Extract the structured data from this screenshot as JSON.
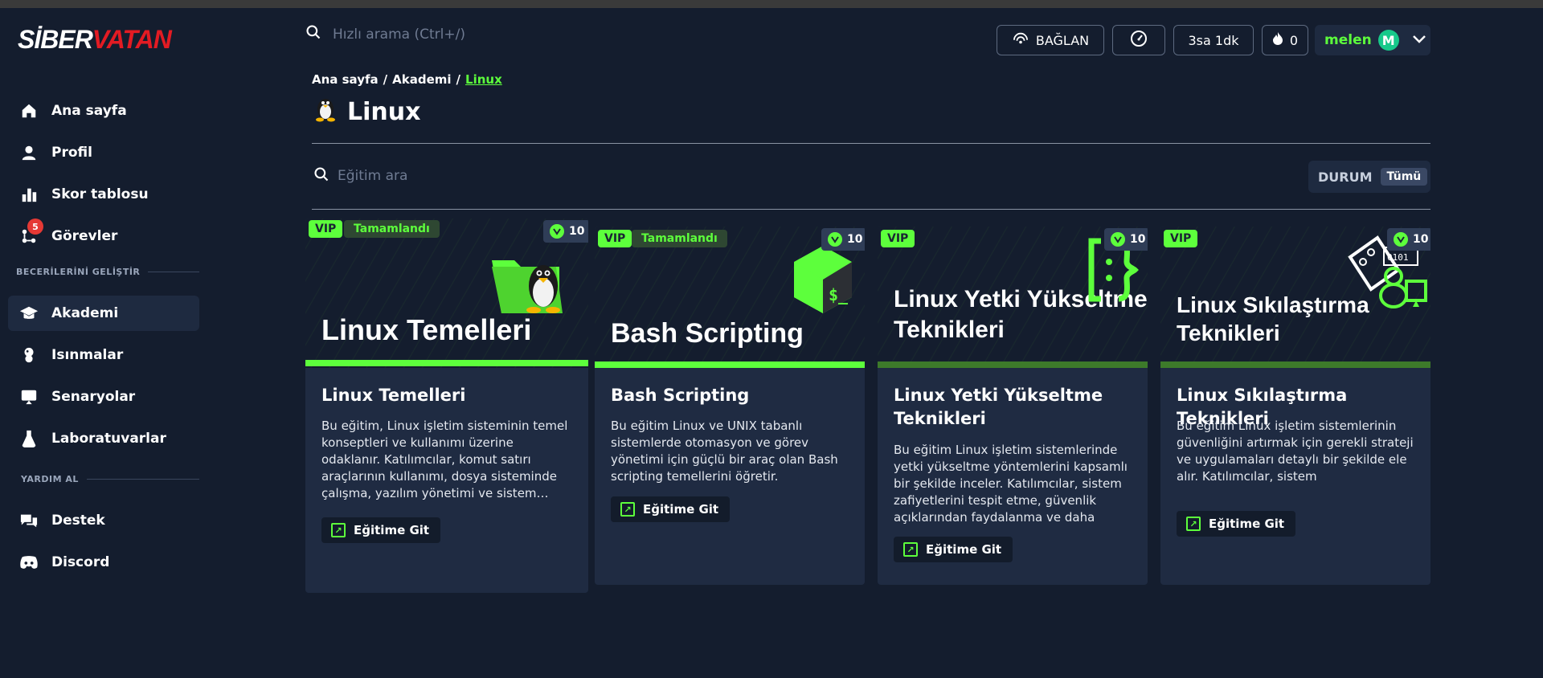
{
  "brand": {
    "logo_part1": "SİBER",
    "logo_part2": "VATAN"
  },
  "sidebar": {
    "items": [
      {
        "label": "Ana sayfa",
        "icon": "home-icon"
      },
      {
        "label": "Profil",
        "icon": "user-icon"
      },
      {
        "label": "Skor tablosu",
        "icon": "bar-chart-icon"
      },
      {
        "label": "Görevler",
        "icon": "tasks-icon",
        "badge": "5"
      },
      {
        "label": "Akademi",
        "icon": "graduation-cap-icon"
      },
      {
        "label": "Isınmalar",
        "icon": "warmup-icon"
      },
      {
        "label": "Senaryolar",
        "icon": "scenario-icon"
      },
      {
        "label": "Laboratuvarlar",
        "icon": "flask-icon"
      },
      {
        "label": "Destek",
        "icon": "chat-icon"
      },
      {
        "label": "Discord",
        "icon": "discord-icon"
      }
    ],
    "sections": {
      "develop": "BECERİLERİNİ GELİŞTİR",
      "help": "YARDIM AL"
    }
  },
  "header": {
    "search_placeholder": "Hızlı arama (Ctrl+/)",
    "connect_label": "BAĞLAN",
    "time_label": "3sa 1dk",
    "flame_count": "0",
    "username": "melen",
    "avatar_letter": "M"
  },
  "breadcrumb": {
    "home": "Ana sayfa",
    "sep": "/",
    "academy": "Akademi",
    "current": "Linux"
  },
  "page": {
    "title": "Linux"
  },
  "filters": {
    "search_placeholder": "Eğitim ara",
    "status_label": "DURUM",
    "status_value": "Tümü"
  },
  "colors": {
    "accent": "#5dff3c",
    "background": "#141d2e",
    "card": "#1f2b42",
    "badge": "#e53935"
  },
  "courses": [
    {
      "vip": "VIP",
      "status": "Tamamlandı",
      "points": "10",
      "hero_title": "Linux Temelleri",
      "title": "Linux Temelleri",
      "description": "Bu eğitim, Linux işletim sisteminin temel konseptleri ve kullanımı üzerine odaklanır. Katılımcılar, komut satırı araçlarının kullanımı, dosya sisteminde çalışma, yazılım yönetimi ve sistem…",
      "button": "Eğitime Git",
      "art": "tux-folder-icon"
    },
    {
      "vip": "VIP",
      "status": "Tamamlandı",
      "points": "10",
      "hero_title": "Bash Scripting",
      "title": "Bash Scripting",
      "description": "Bu eğitim Linux ve UNIX tabanlı sistemlerde otomasyon ve görev yönetimi için güçlü bir araç olan Bash scripting temellerini öğretir.",
      "button": "Eğitime Git",
      "art": "bash-cube-icon"
    },
    {
      "vip": "VIP",
      "status": "",
      "points": "10",
      "hero_title": "Linux Yetki Yükseltme Teknikleri",
      "title": "Linux Yetki Yükseltme Teknikleri",
      "description": "Bu eğitim Linux işletim sistemlerinde yetki yükseltme yöntemlerini kapsamlı bir şekilde inceler. Katılımcılar, sistem zafiyetlerini tespit etme, güvenlik açıklarından faydalanma ve daha yüks…",
      "button": "Eğitime Git",
      "art": "brackets-icon"
    },
    {
      "vip": "VIP",
      "status": "",
      "points": "10",
      "hero_title": "Linux Sıkılaştırma Teknikleri",
      "title": "Linux Sıkılaştırma Teknikleri",
      "description": "Bu eğitim Linux işletim sistemlerinin güvenliğini artırmak için gerekli strateji ve uygulamaları detaylı bir şekilde ele alır. Katılımcılar, sistem yapılandırmalarını güvenli hale getirme tekniklerini…",
      "button": "Eğitime Git",
      "art": "hardening-icon"
    }
  ]
}
